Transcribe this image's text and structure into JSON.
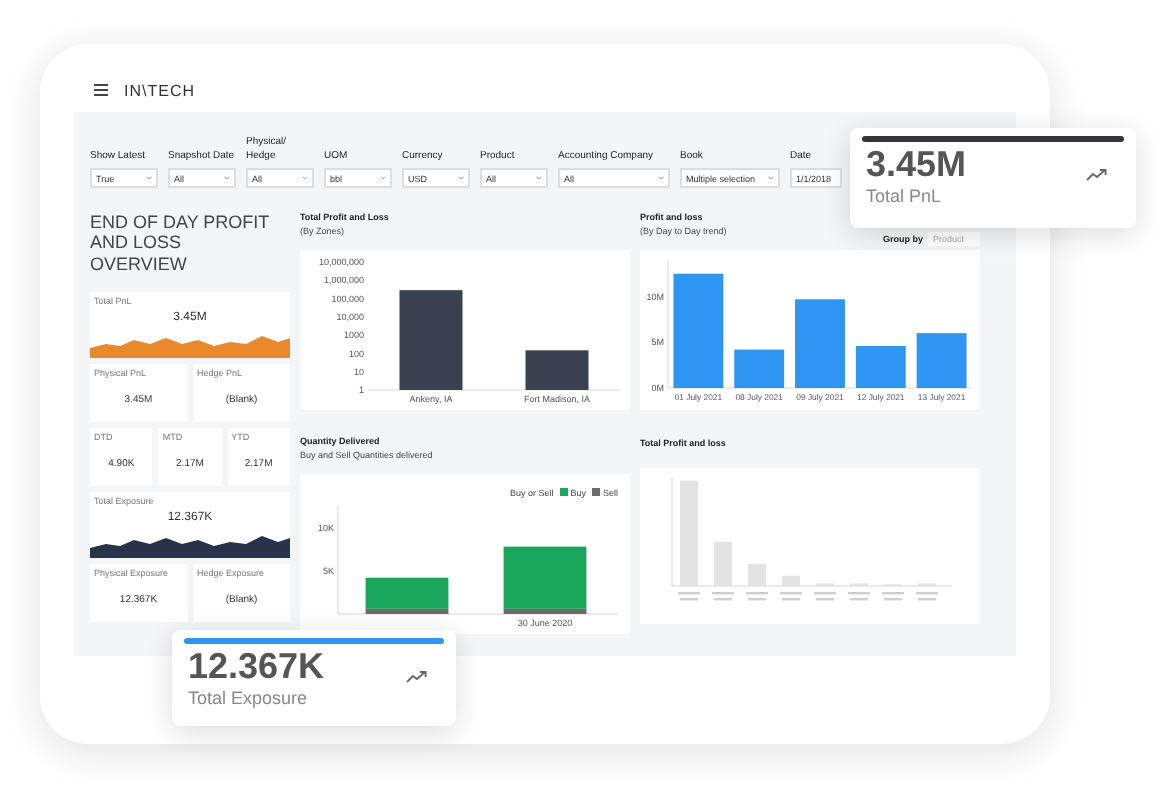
{
  "header": {
    "logo": "IN\\TECH"
  },
  "filters": [
    {
      "label": "Show Latest",
      "value": "True"
    },
    {
      "label": "Snapshot Date",
      "value": "All"
    },
    {
      "label": "Physical/ Hedge",
      "value": "All"
    },
    {
      "label": "UOM",
      "value": "bbl"
    },
    {
      "label": "Currency",
      "value": "USD"
    },
    {
      "label": "Product",
      "value": "All"
    },
    {
      "label": "Accounting Company",
      "value": "All"
    },
    {
      "label": "Book",
      "value": "Multiple selection"
    },
    {
      "label": "Date",
      "value": "1/1/2018"
    }
  ],
  "overview": {
    "title": "END OF DAY PROFIT AND LOSS OVERVIEW",
    "kpi_rows": [
      [
        {
          "kind": "sparkline",
          "label": "Total PnL",
          "value": "3.45M",
          "color": "#e8892b"
        }
      ],
      [
        {
          "kind": "plain",
          "label": "Physical PnL",
          "value": "3.45M"
        },
        {
          "kind": "plain",
          "label": "Hedge PnL",
          "value": "(Blank)"
        }
      ],
      [
        {
          "kind": "plain",
          "label": "DTD",
          "value": "4.90K"
        },
        {
          "kind": "plain",
          "label": "MTD",
          "value": "2.17M"
        },
        {
          "kind": "plain",
          "label": "YTD",
          "value": "2.17M"
        }
      ],
      [
        {
          "kind": "sparkline",
          "label": "Total Exposure",
          "value": "12.367K",
          "color": "#26334a"
        }
      ],
      [
        {
          "kind": "plain",
          "label": "Physical Exposure",
          "value": "12.367K"
        },
        {
          "kind": "plain",
          "label": "Hedge Exposure",
          "value": "(Blank)"
        }
      ]
    ]
  },
  "zones_chart": {
    "title": "Total Profit and Loss",
    "subtitle": "(By Zones)",
    "axis_labels": [
      "10,000,000",
      "1,000,000",
      "100,000",
      "10,000",
      "1000",
      "100",
      "10",
      "1"
    ],
    "category_labels": [
      "Ankeny, IA",
      "Fort Madison, IA"
    ]
  },
  "trend_chart": {
    "title": "Profit and loss",
    "subtitle": "(By Day to Day trend)",
    "group_by": {
      "label": "Group by",
      "value": "Product"
    },
    "chart_data": {
      "type": "bar",
      "categories": [
        "01 July 2021",
        "08 July 2021",
        "09 July 2021",
        "12 July 2021",
        "13 July 2021"
      ],
      "series": [
        {
          "color": "#2f95f2",
          "values": [
            12500000,
            4200000,
            9700000,
            4600000,
            6000000
          ]
        }
      ],
      "ylim": [
        0,
        14000000
      ],
      "yticks": [
        {
          "value": 0,
          "label": "0M"
        },
        {
          "value": 5000000,
          "label": "5M"
        },
        {
          "value": 10000000,
          "label": "10M"
        }
      ]
    }
  },
  "quantity_chart": {
    "title": "Quantity Delivered",
    "subtitle": "Buy and Sell Quantities delivered",
    "legend_title": "Buy or Sell",
    "chart_data": {
      "type": "bar",
      "stacked": true,
      "categories": [
        null,
        "30 June 2020"
      ],
      "series": [
        {
          "name": "Buy",
          "color": "#1aa65a",
          "values": [
            3600,
            7200
          ]
        },
        {
          "name": "Sell",
          "color": "#6b6b6b",
          "values": [
            600,
            600
          ]
        }
      ],
      "ylim": [
        0,
        12500
      ],
      "yticks": [
        {
          "value": 5000,
          "label": "5K"
        },
        {
          "value": 10000,
          "label": "10K"
        }
      ]
    }
  },
  "loss_chart": {
    "title": "Total Profit and loss"
  },
  "floating_cards": [
    {
      "value": "3.45M",
      "label": "Total PnL",
      "color": "#33363d"
    },
    {
      "value": "12.367K",
      "label": "Total Exposure",
      "color": "#2f95f2"
    }
  ]
}
